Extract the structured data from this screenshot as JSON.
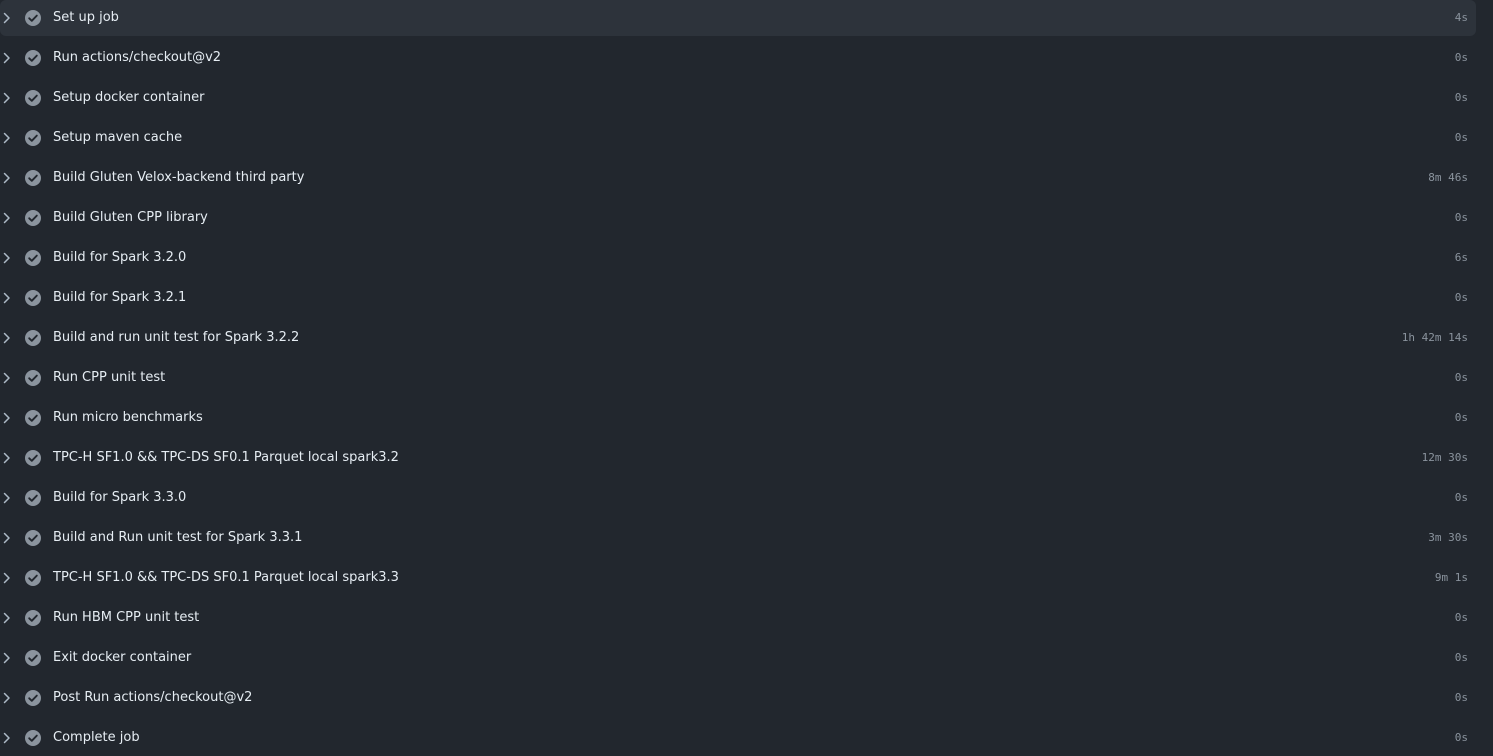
{
  "job": {
    "steps": [
      {
        "name": "Set up job",
        "duration": "4s",
        "status": "success",
        "active": true
      },
      {
        "name": "Run actions/checkout@v2",
        "duration": "0s",
        "status": "success",
        "active": false
      },
      {
        "name": "Setup docker container",
        "duration": "0s",
        "status": "success",
        "active": false
      },
      {
        "name": "Setup maven cache",
        "duration": "0s",
        "status": "success",
        "active": false
      },
      {
        "name": "Build Gluten Velox-backend third party",
        "duration": "8m 46s",
        "status": "success",
        "active": false
      },
      {
        "name": "Build Gluten CPP library",
        "duration": "0s",
        "status": "success",
        "active": false
      },
      {
        "name": "Build for Spark 3.2.0",
        "duration": "6s",
        "status": "success",
        "active": false
      },
      {
        "name": "Build for Spark 3.2.1",
        "duration": "0s",
        "status": "success",
        "active": false
      },
      {
        "name": "Build and run unit test for Spark 3.2.2",
        "duration": "1h 42m 14s",
        "status": "success",
        "active": false
      },
      {
        "name": "Run CPP unit test",
        "duration": "0s",
        "status": "success",
        "active": false
      },
      {
        "name": "Run micro benchmarks",
        "duration": "0s",
        "status": "success",
        "active": false
      },
      {
        "name": "TPC-H SF1.0 && TPC-DS SF0.1 Parquet local spark3.2",
        "duration": "12m 30s",
        "status": "success",
        "active": false
      },
      {
        "name": "Build for Spark 3.3.0",
        "duration": "0s",
        "status": "success",
        "active": false
      },
      {
        "name": "Build and Run unit test for Spark 3.3.1",
        "duration": "3m 30s",
        "status": "success",
        "active": false
      },
      {
        "name": "TPC-H SF1.0 && TPC-DS SF0.1 Parquet local spark3.3",
        "duration": "9m 1s",
        "status": "success",
        "active": false
      },
      {
        "name": "Run HBM CPP unit test",
        "duration": "0s",
        "status": "success",
        "active": false
      },
      {
        "name": "Exit docker container",
        "duration": "0s",
        "status": "success",
        "active": false
      },
      {
        "name": "Post Run actions/checkout@v2",
        "duration": "0s",
        "status": "success",
        "active": false
      },
      {
        "name": "Complete job",
        "duration": "0s",
        "status": "success",
        "active": false
      }
    ]
  },
  "icons": {
    "expand": "chevron-right-icon",
    "status": "check-circle-icon"
  },
  "colors": {
    "background": "#22272e",
    "active_row": "#2d333b",
    "text": "#e6edf3",
    "muted": "#8b949e",
    "check_circle": "#8b949e",
    "check_mark": "#22272e"
  }
}
